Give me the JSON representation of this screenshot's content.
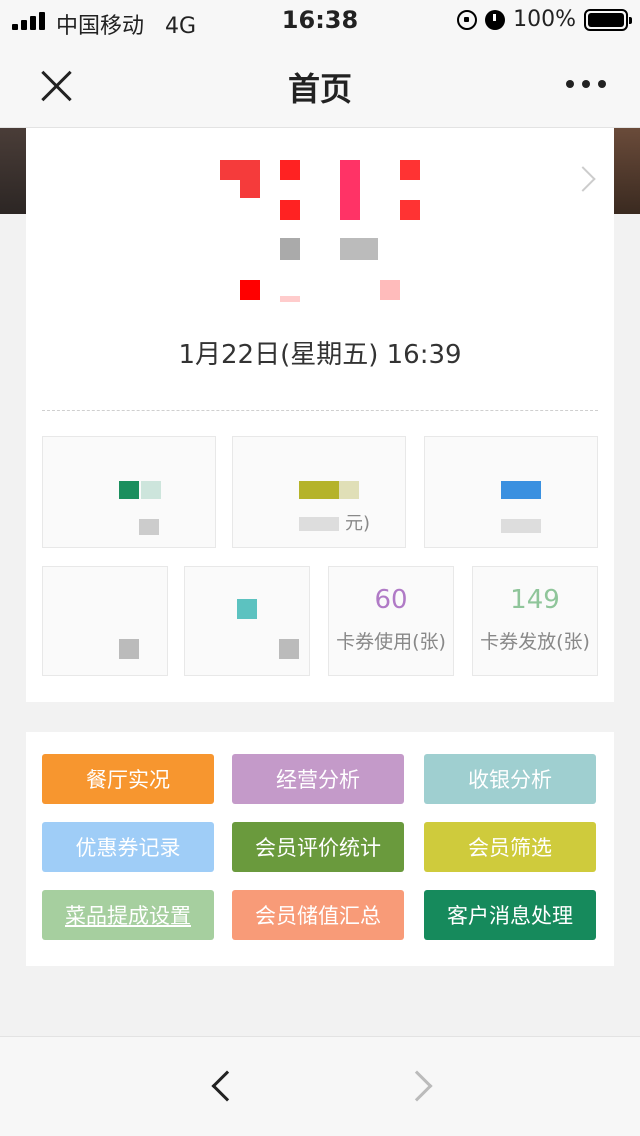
{
  "status_bar": {
    "carrier": "中国移动",
    "network": "4G",
    "time": "16:38",
    "battery": "100%"
  },
  "nav": {
    "title": "首页"
  },
  "dashboard": {
    "datetime": "1月22日(星期五) 16:39",
    "stats_row2": [
      {
        "value": "60",
        "label": "卡券使用(张)",
        "color": "#b07ac6"
      },
      {
        "value": "149",
        "label": "卡券发放(张)",
        "color": "#8fc59a"
      }
    ],
    "partial_labels": {
      "unit_yuan": "元)"
    }
  },
  "actions": [
    {
      "label": "餐厅实况",
      "color": "#f7962f"
    },
    {
      "label": "经营分析",
      "color": "#c49ac9"
    },
    {
      "label": "收银分析",
      "color": "#9fcfd0"
    },
    {
      "label": "优惠券记录",
      "color": "#9fcdf7"
    },
    {
      "label": "会员评价统计",
      "color": "#6a9a3d"
    },
    {
      "label": "会员筛选",
      "color": "#cfcb3c"
    },
    {
      "label": "菜品提成设置",
      "color": "#a6cf9f"
    },
    {
      "label": "会员储值汇总",
      "color": "#f89b78"
    },
    {
      "label": "客户消息处理",
      "color": "#168a5c"
    }
  ]
}
